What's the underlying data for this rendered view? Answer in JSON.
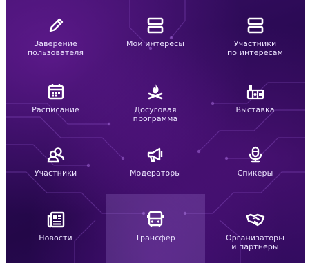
{
  "colors": {
    "background_dark": "#2b0a55",
    "background_glow": "#8c28be",
    "icon": "#ffffff",
    "label": "#ece4ff",
    "active_tile": "#b496e6"
  },
  "menu": {
    "items": [
      {
        "label": "Заверение\nпользователя",
        "icon": "pencil-icon"
      },
      {
        "label": "Мои интересы",
        "icon": "server-icon"
      },
      {
        "label": "Участники\nпо интересам",
        "icon": "server-icon"
      },
      {
        "label": "Расписание",
        "icon": "calendar-icon"
      },
      {
        "label": "Досуговая\nпрограмма",
        "icon": "campfire-icon"
      },
      {
        "label": "Выставка",
        "icon": "exhibition-icon"
      },
      {
        "label": "Участники",
        "icon": "users-icon"
      },
      {
        "label": "Модераторы",
        "icon": "megaphone-icon"
      },
      {
        "label": "Спикеры",
        "icon": "microphone-icon"
      },
      {
        "label": "Новости",
        "icon": "newspaper-icon"
      },
      {
        "label": "Трансфер",
        "icon": "bus-icon"
      },
      {
        "label": "Организаторы\nи партнеры",
        "icon": "handshake-icon"
      }
    ],
    "active_index": 10
  }
}
